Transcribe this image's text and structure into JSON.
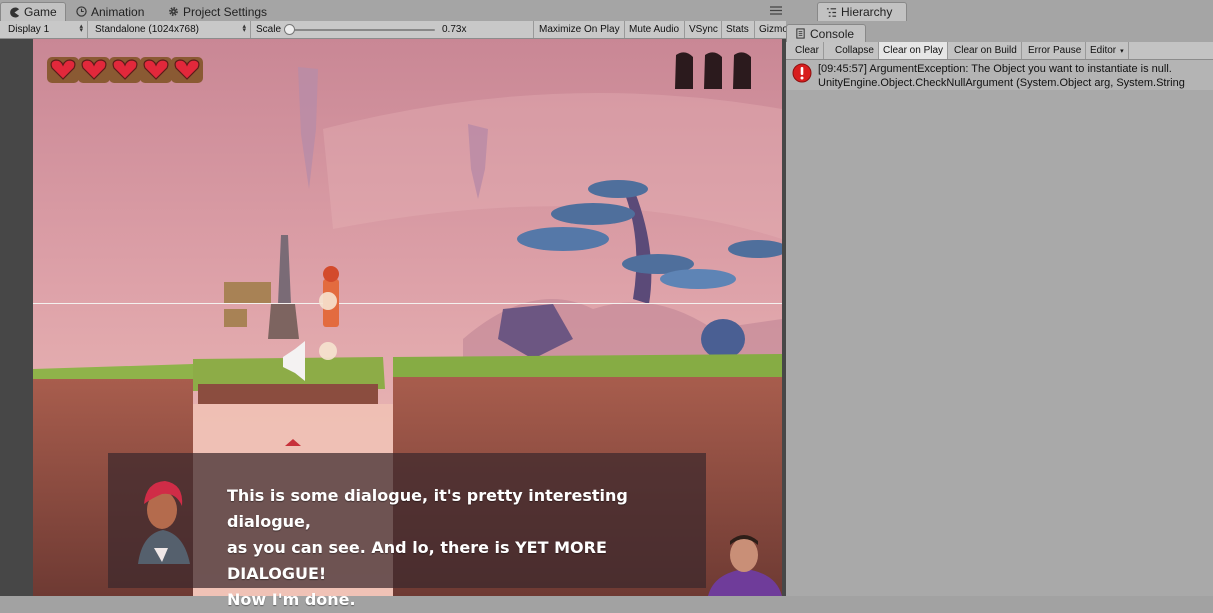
{
  "tabs": {
    "game": "Game",
    "animation": "Animation",
    "project_settings": "Project Settings",
    "hierarchy": "Hierarchy",
    "console": "Console"
  },
  "game_toolbar": {
    "display": "Display 1",
    "resolution": "Standalone (1024x768)",
    "scale_label": "Scale",
    "scale_value": "0.73x",
    "maximize_on_play": "Maximize On Play",
    "mute_audio": "Mute Audio",
    "vsync": "VSync",
    "stats": "Stats",
    "gizmos": "Gizmo"
  },
  "console_toolbar": {
    "clear": "Clear",
    "collapse": "Collapse",
    "clear_on_play": "Clear on Play",
    "clear_on_build": "Clear on Build",
    "error_pause": "Error Pause",
    "editor": "Editor"
  },
  "console_log": {
    "line1": "[09:45:57] ArgumentException: The Object you want to instantiate is null.",
    "line2": "UnityEngine.Object.CheckNullArgument (System.Object arg, System.String"
  },
  "game": {
    "hearts": 5,
    "dialogue": [
      "This is some dialogue, it's pretty interesting dialogue,",
      "as you can see. And lo, there is YET MORE DIALOGUE!",
      "Now I'm done."
    ]
  },
  "icons": {
    "game_tab": "pacman-icon",
    "animation_tab": "clock-icon",
    "settings_tab": "gear-icon",
    "hierarchy_tab": "list-icon",
    "console_tab": "console-icon",
    "error": "error-icon"
  },
  "colors": {
    "error_red": "#d81e1e",
    "heart_red": "#e2283b",
    "sky_pink": "#e0a6ad"
  }
}
